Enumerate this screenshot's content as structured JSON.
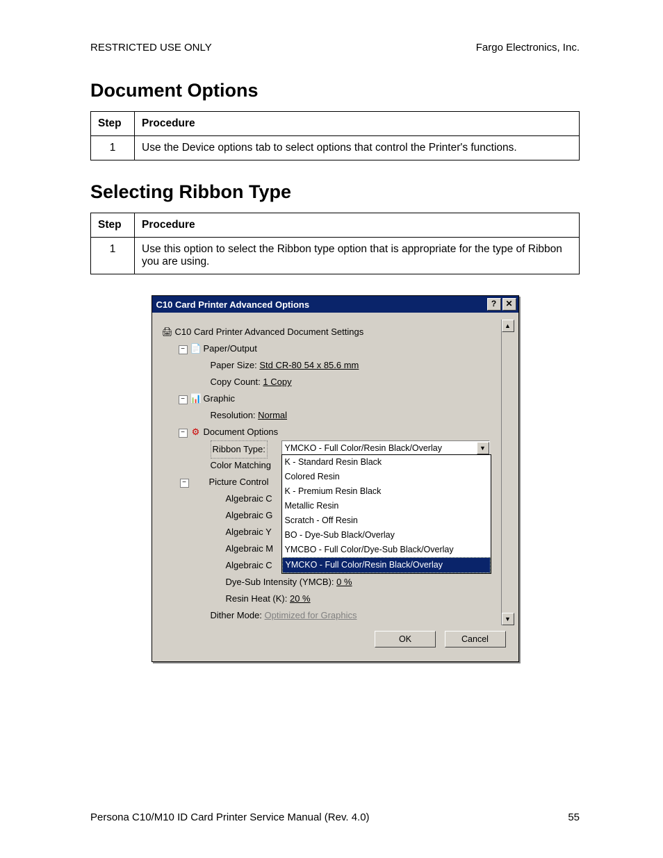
{
  "header": {
    "left": "RESTRICTED USE ONLY",
    "right": "Fargo Electronics, Inc."
  },
  "section1": {
    "heading": "Document Options",
    "th_step": "Step",
    "th_proc": "Procedure",
    "rows": [
      {
        "step": "1",
        "text": "Use the Device options tab to select options that control the Printer's functions."
      }
    ]
  },
  "section2": {
    "heading": "Selecting Ribbon Type",
    "th_step": "Step",
    "th_proc": "Procedure",
    "rows": [
      {
        "step": "1",
        "text": "Use this option to select the Ribbon type option that is appropriate for the type of Ribbon you are using."
      }
    ]
  },
  "dialog": {
    "title": "C10 Card Printer Advanced Options",
    "root": "C10 Card Printer Advanced Document Settings",
    "paper_output": "Paper/Output",
    "paper_size_label": "Paper Size: ",
    "paper_size_value": "Std CR-80  54 x 85.6 mm",
    "copy_count_label": "Copy Count: ",
    "copy_count_value": "1 Copy",
    "graphic": "Graphic",
    "resolution_label": "Resolution: ",
    "resolution_value": "Normal",
    "doc_options": "Document Options",
    "ribbon_label": "Ribbon Type:",
    "ribbon_value": "YMCKO - Full Color/Resin Black/Overlay",
    "color_matching": "Color Matching",
    "picture_controls": "Picture Control",
    "alg_c": "Algebraic C",
    "alg_g": "Algebraic G",
    "alg_y": "Algebraic Y",
    "alg_m": "Algebraic M",
    "alg_co": "Algebraic C",
    "dye_sub_label": "Dye-Sub Intensity (YMCB): ",
    "dye_sub_value": "0 %",
    "resin_label": "Resin Heat (K): ",
    "resin_value": "20 %",
    "dither_label": "Dither Mode: ",
    "dither_value": "Optimized for Graphics",
    "dropdown_options": [
      "K - Standard Resin Black",
      "Colored Resin",
      "K - Premium Resin Black",
      "Metallic Resin",
      "Scratch - Off Resin",
      "BO - Dye-Sub Black/Overlay",
      "YMCBO - Full Color/Dye-Sub Black/Overlay",
      "YMCKO - Full Color/Resin Black/Overlay"
    ],
    "ok": "OK",
    "cancel": "Cancel"
  },
  "footer": {
    "left": "Persona C10/M10 ID Card Printer Service Manual (Rev. 4.0)",
    "right": "55"
  }
}
